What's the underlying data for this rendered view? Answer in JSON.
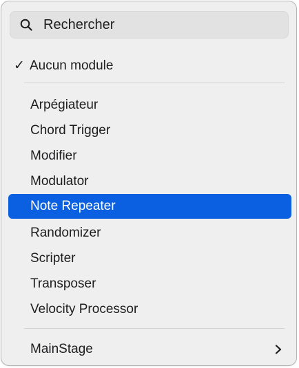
{
  "search": {
    "placeholder": "Rechercher",
    "icon": "search-icon"
  },
  "menu": {
    "checked_item": {
      "checkmark": "✓",
      "label": "Aucun module"
    },
    "items": [
      {
        "label": "Arpégiateur"
      },
      {
        "label": "Chord Trigger"
      },
      {
        "label": "Modifier"
      },
      {
        "label": "Modulator"
      },
      {
        "label": "Note Repeater",
        "selected": true
      },
      {
        "label": "Randomizer"
      },
      {
        "label": "Scripter"
      },
      {
        "label": "Transposer"
      },
      {
        "label": "Velocity Processor"
      }
    ],
    "submenu_item": {
      "label": "MainStage",
      "icon": "chevron-right-icon"
    }
  },
  "colors": {
    "highlight": "#0a60e0",
    "background": "#efefef"
  }
}
